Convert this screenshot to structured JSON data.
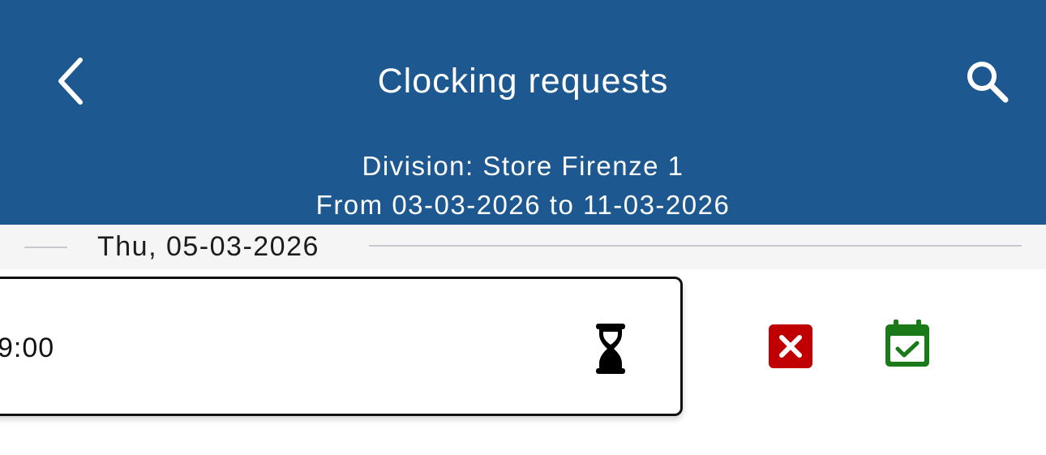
{
  "header": {
    "title": "Clocking requests",
    "division": "Division: Store Firenze 1",
    "date_range": "From 03-03-2026 to 11-03-2026",
    "back_icon": "chevron-left-icon",
    "search_icon": "search-icon"
  },
  "date_group": {
    "label": "Thu, 05-03-2026"
  },
  "request": {
    "time": "9:00",
    "status_icon": "hourglass-icon",
    "reject_icon": "close-box-icon",
    "approve_icon": "calendar-check-icon"
  },
  "colors": {
    "header_bg": "#1d5891",
    "reject": "#c00000",
    "approve": "#1a7a1a"
  }
}
